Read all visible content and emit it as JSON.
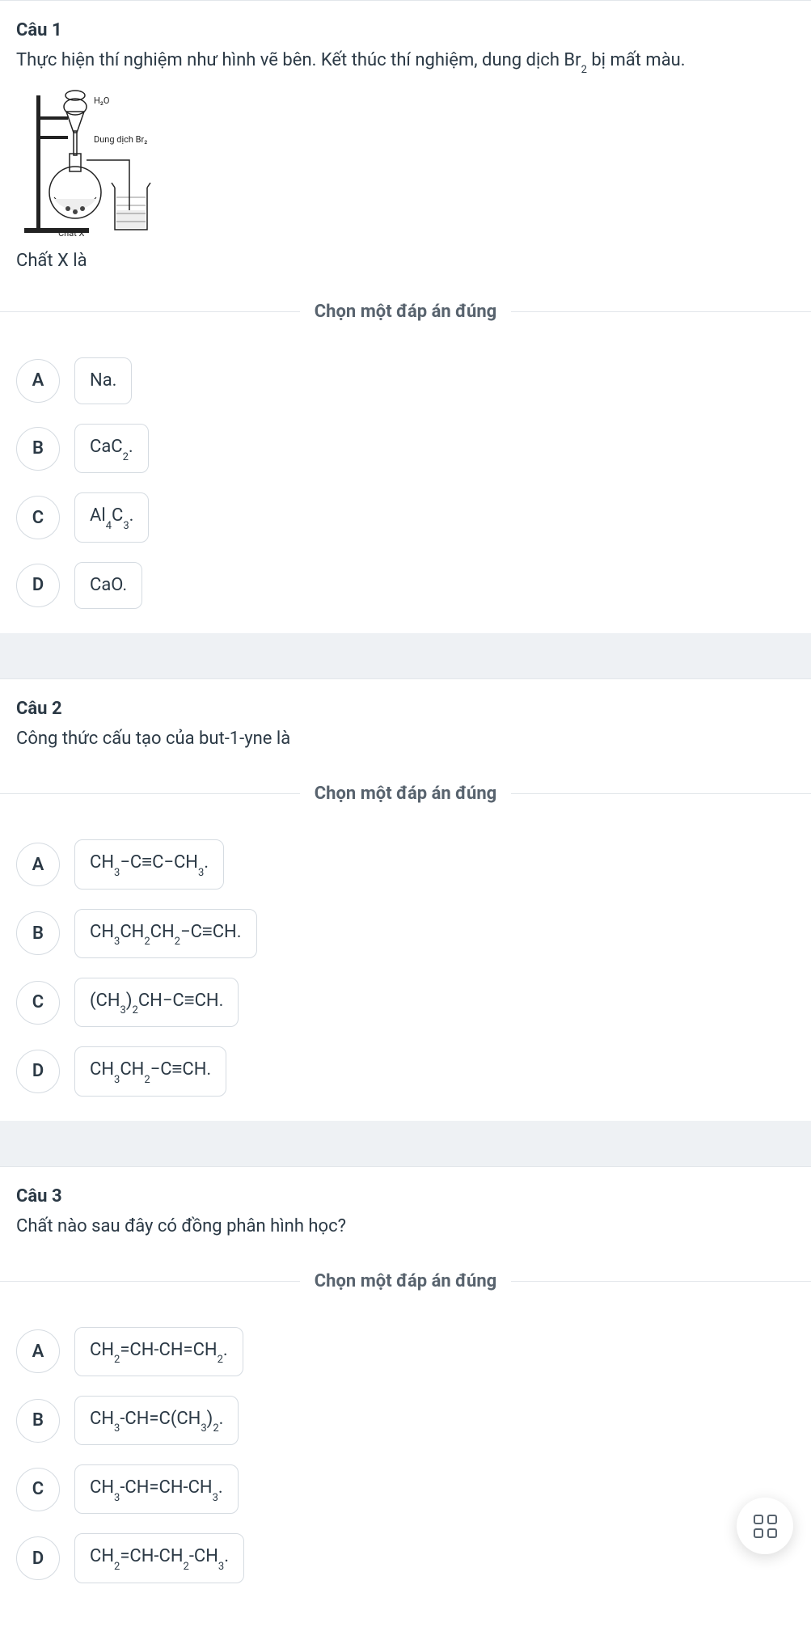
{
  "prompt_label": "Chọn một đáp án đúng",
  "fab_name": "Grid",
  "diagram": {
    "h2o": "H₂O",
    "br": "Dung dịch Br₂",
    "x": "Chất X"
  },
  "questions": [
    {
      "title": "Câu 1",
      "body_html": "Thực hiện thí nghiệm như hình vẽ bên. Kết thúc thí nghiệm, dung dịch Br<span class='sub'>2</span> bị mất màu.",
      "after_img": "Chất X là",
      "has_diagram": true,
      "options": [
        {
          "letter": "A",
          "html": "Na."
        },
        {
          "letter": "B",
          "html": "CaC<span class='sub'>2</span>."
        },
        {
          "letter": "C",
          "html": "Al<span class='sub'>4</span>C<span class='sub'>3</span>."
        },
        {
          "letter": "D",
          "html": "CaO."
        }
      ]
    },
    {
      "title": "Câu 2",
      "body_html": "Công thức cấu tạo của but-1-yne là",
      "has_diagram": false,
      "options": [
        {
          "letter": "A",
          "html": "CH<span class='sub'>3</span>−C≡C−CH<span class='sub'>3</span>."
        },
        {
          "letter": "B",
          "html": "CH<span class='sub'>3</span>CH<span class='sub'>2</span>CH<span class='sub'>2</span>−C≡CH."
        },
        {
          "letter": "C",
          "html": "(CH<span class='sub'>3</span>)<span class='sub'>2</span>CH−C≡CH."
        },
        {
          "letter": "D",
          "html": "CH<span class='sub'>3</span>CH<span class='sub'>2</span>−C≡CH."
        }
      ]
    },
    {
      "title": "Câu 3",
      "body_html": "Chất nào sau đây có đồng phân hình học?",
      "has_diagram": false,
      "options": [
        {
          "letter": "A",
          "html": "CH<span class='sub'>2</span>=CH-CH=CH<span class='sub'>2</span>."
        },
        {
          "letter": "B",
          "html": "CH<span class='sub'>3</span>-CH=C(CH<span class='sub'>3</span>)<span class='sub'>2</span>."
        },
        {
          "letter": "C",
          "html": "CH<span class='sub'>3</span>-CH=CH-CH<span class='sub'>3</span>."
        },
        {
          "letter": "D",
          "html": "CH<span class='sub'>2</span>=CH-CH<span class='sub'>2</span>-CH<span class='sub'>3</span>."
        }
      ]
    }
  ]
}
